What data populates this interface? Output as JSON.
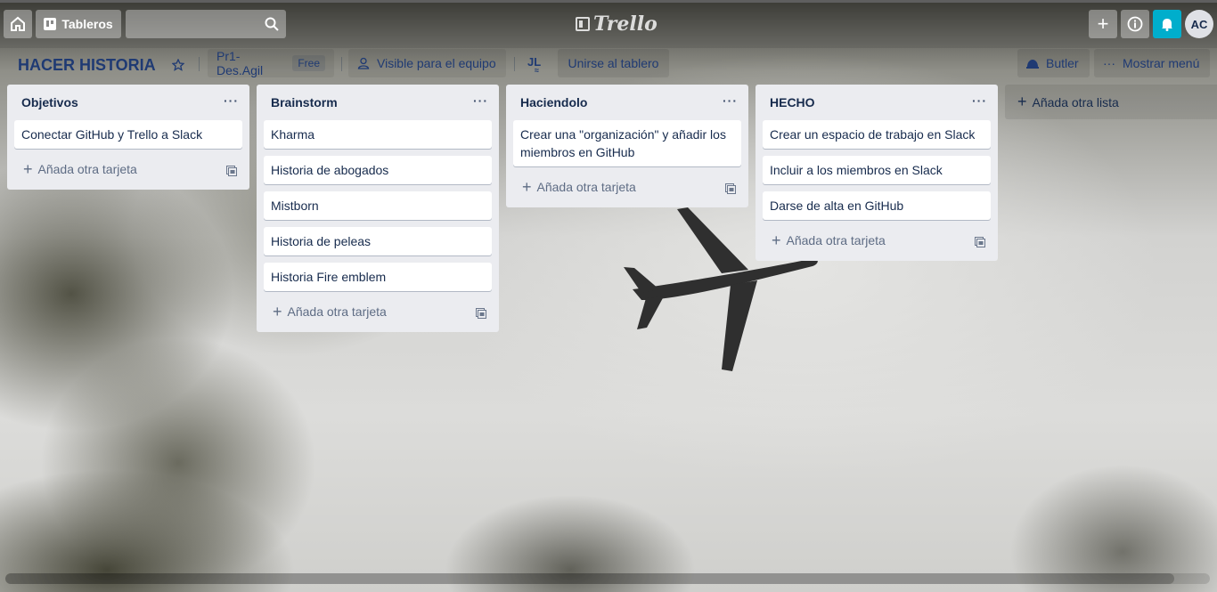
{
  "topbar": {
    "boards_label": "Tableros",
    "search_placeholder": "",
    "logo_text": "Trello",
    "avatar_initials": "AC",
    "accent_color": "#00aecc"
  },
  "board": {
    "title": "HACER HISTORIA",
    "team_name": "Pr1-Des.Agil",
    "team_plan": "Free",
    "visibility_label": "Visible para el equipo",
    "member_initials": "JL",
    "join_label": "Unirse al tablero",
    "butler_label": "Butler",
    "menu_label": "Mostrar menú"
  },
  "lists": [
    {
      "title": "Objetivos",
      "cards": [
        "Conectar GitHub y Trello a Slack"
      ],
      "add_card_label": "Añada otra tarjeta"
    },
    {
      "title": "Brainstorm",
      "cards": [
        "Kharma",
        "Historia de abogados",
        "Mistborn",
        "Historia de peleas",
        "Historia Fire emblem"
      ],
      "add_card_label": "Añada otra tarjeta"
    },
    {
      "title": "Haciendolo",
      "cards": [
        "Crear una \"organización\" y añadir los miembros en GitHub"
      ],
      "add_card_label": "Añada otra tarjeta"
    },
    {
      "title": "HECHO",
      "cards": [
        "Crear un espacio de trabajo en Slack",
        "Incluir a los miembros en Slack",
        "Darse de alta en GitHub"
      ],
      "add_card_label": "Añada otra tarjeta"
    }
  ],
  "add_list_label": "Añada otra lista",
  "list_menu_glyph": "···"
}
